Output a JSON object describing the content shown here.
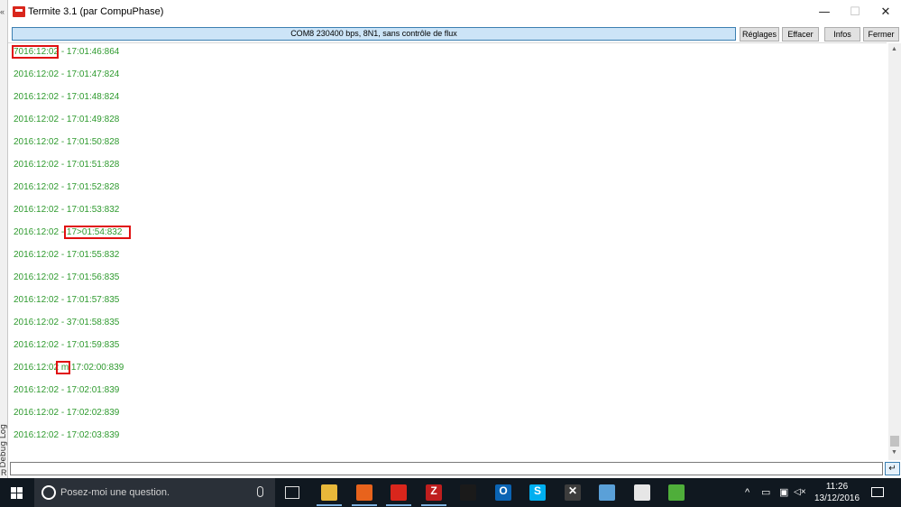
{
  "window": {
    "title": "Termite 3.1 (par CompuPhase)",
    "controls": {
      "minimize": "—",
      "maximize": "☐",
      "close": "✕"
    }
  },
  "background_window": {
    "vertical_label": "Debug Log",
    "letter": "R",
    "chevron": "«"
  },
  "toolbar": {
    "status": "COM8 230400 bps, 8N1, sans contrôle de flux",
    "buttons": [
      "Réglages",
      "Effacer",
      "Infos",
      "Fermer"
    ]
  },
  "output": {
    "text_color": "#2e9a2e",
    "highlight_color": "#e01010",
    "lines": [
      "7016:12:02 - 17:01:46:864",
      "2016:12:02 - 17:01:47:824",
      "2016:12:02 - 17:01:48:824",
      "2016:12:02 - 17:01:49:828",
      "2016:12:02 - 17:01:50:828",
      "2016:12:02 - 17:01:51:828",
      "2016:12:02 - 17:01:52:828",
      "2016:12:02 - 17:01:53:832",
      "2016:12:02 - 17>01:54:832",
      "2016:12:02 - 17:01:55:832",
      "2016:12:02 - 17:01:56:835",
      "2016:12:02 - 17:01:57:835",
      "2016:12:02 - 37:01:58:835",
      "2016:12:02 - 17:01:59:835",
      "2016:12:02 m 17:02:00:839",
      "2016:12:02 - 17:02:01:839",
      "2016:12:02 - 17:02:02:839",
      "2016:12:02 - 17:02:03:839"
    ]
  },
  "input": {
    "value": "",
    "send_icon": "↵"
  },
  "taskbar": {
    "search_placeholder": "Posez-moi une question.",
    "apps": [
      {
        "name": "file-explorer",
        "glyph": "",
        "color": "#e8b83a",
        "active": true
      },
      {
        "name": "firefox",
        "glyph": "",
        "color": "#e8631c",
        "active": true
      },
      {
        "name": "termite",
        "glyph": "",
        "color": "#d9261c",
        "active": true
      },
      {
        "name": "filezilla",
        "glyph": "Z",
        "color": "#bf1e1e",
        "active": true
      },
      {
        "name": "command-prompt",
        "glyph": "",
        "color": "#1a1a1a",
        "active": false
      },
      {
        "name": "outlook",
        "glyph": "O",
        "color": "#0a64b4",
        "active": false
      },
      {
        "name": "skype",
        "glyph": "S",
        "color": "#00aff0",
        "active": false
      },
      {
        "name": "tools",
        "glyph": "✕",
        "color": "#3c3c3c",
        "active": false
      },
      {
        "name": "paint",
        "glyph": "",
        "color": "#5aa0d8",
        "active": false
      },
      {
        "name": "photos",
        "glyph": "",
        "color": "#e6e6e6",
        "active": false
      },
      {
        "name": "green-app",
        "glyph": "",
        "color": "#4fae3a",
        "active": false
      }
    ],
    "tray_icons": [
      "^",
      "▭",
      "▣",
      "◁×"
    ],
    "time": "11:26",
    "date": "13/12/2016"
  }
}
